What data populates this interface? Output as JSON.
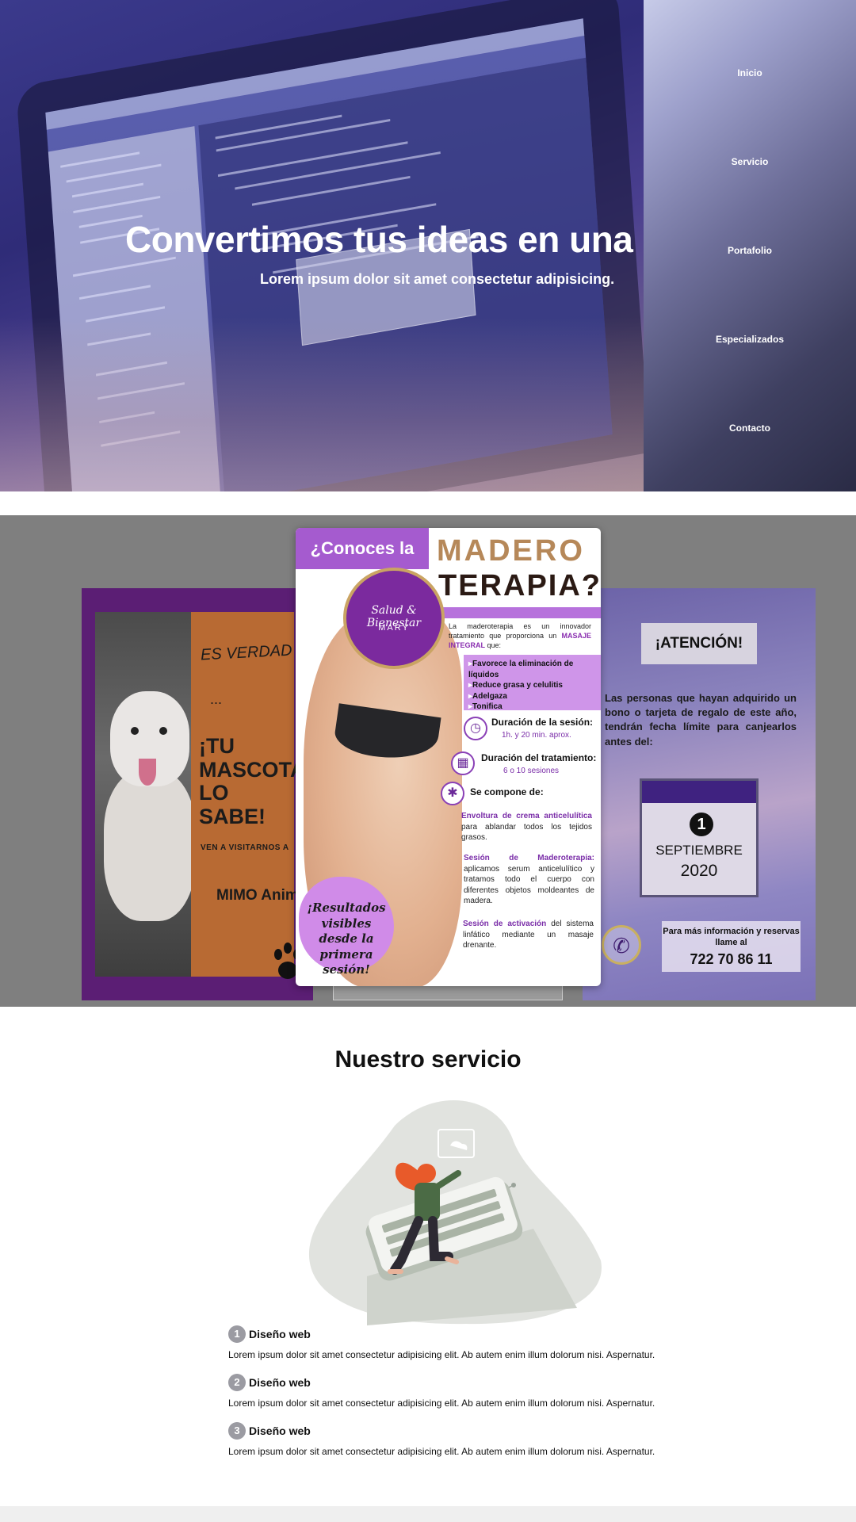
{
  "hero": {
    "title": "Convertimos tus ideas en una rea",
    "subtitle": "Lorem ipsum dolor sit amet consectetur adipisicing."
  },
  "nav": {
    "items": [
      {
        "label": "Inicio"
      },
      {
        "label": "Servicio"
      },
      {
        "label": "Portafolio"
      },
      {
        "label": "Especializados"
      },
      {
        "label": "Contacto"
      }
    ]
  },
  "portfolio": {
    "dog_card": {
      "line1": "ES VERDAD Y",
      "line2": "...",
      "line3": "¡TU MASCOTA LO SABE!",
      "line4": "VEN A VISITARNOS A",
      "line5": "MIMO Animal"
    },
    "main_card": {
      "header_left": "¿Conoces la",
      "header_right_1": "MADERO",
      "header_right_2": "TERAPIA?",
      "logo_line1": "Salud & Bienestar",
      "logo_line2": "MARY",
      "intro_a": "La maderoterapia es un innovador tratamiento que proporciona un ",
      "intro_highlight": "MASAJE INTEGRAL",
      "intro_b": " que:",
      "benefits": [
        "Favorece la eliminación de líquidos",
        "Reduce grasa y celulitis",
        "Adelgaza",
        "Tonifica"
      ],
      "duration_label": "Duración de la sesión:",
      "duration_value": "1h. y 20 min. aprox.",
      "treatment_label": "Duración del tratamiento:",
      "treatment_value": "6 o 10 sesiones",
      "composed_label": "Se compone de:",
      "step1_title": "Envoltura de crema anticelulítica",
      "step1_text": "para ablandar todos los tejidos grasos.",
      "step2_title": "Sesión de Maderoterapia:",
      "step2_text": "aplicamos serum anticelulítico y tratamos todo el cuerpo con diferentes objetos moldeantes de madera.",
      "step3_title": "Sesión de activación",
      "step3_text": " del sistema linfático mediante un masaje drenante.",
      "results": "¡Resultados visibles desde la primera sesión!"
    },
    "attention_card": {
      "badge": "¡ATENCIÓN!",
      "body": "Las personas que hayan adquirido un bono o tarjeta de regalo de este año, tendrán fecha límite para canjearlos antes del:",
      "day": "1",
      "month": "SEPTIEMBRE",
      "year": "2020",
      "phone_label": "Para más información y reservas llame al",
      "phone": "722 70 86 11"
    }
  },
  "services": {
    "title": "Nuestro servicio",
    "items": [
      {
        "num": "1",
        "label": "Diseño web",
        "desc": "Lorem ipsum dolor sit amet consectetur adipisicing elit. Ab autem enim illum dolorum nisi. Aspernatur."
      },
      {
        "num": "2",
        "label": "Diseño web",
        "desc": "Lorem ipsum dolor sit amet consectetur adipisicing elit. Ab autem enim illum dolorum nisi. Aspernatur."
      },
      {
        "num": "3",
        "label": "Diseño web",
        "desc": "Lorem ipsum dolor sit amet consectetur adipisicing elit. Ab autem enim illum dolorum nisi. Aspernatur."
      }
    ]
  },
  "icons": {
    "clock": "clock-icon",
    "calendar": "calendar-icon",
    "puzzle": "puzzle-icon",
    "phone": "phone-icon",
    "paw": "paw-icon"
  },
  "colors": {
    "hero_bg": "#3b3a8c",
    "accent_purple": "#a55bcf",
    "brand_purple": "#7b2a9e",
    "nav_text": "#ffffff",
    "portfolio_bg": "#7f7f7f"
  }
}
